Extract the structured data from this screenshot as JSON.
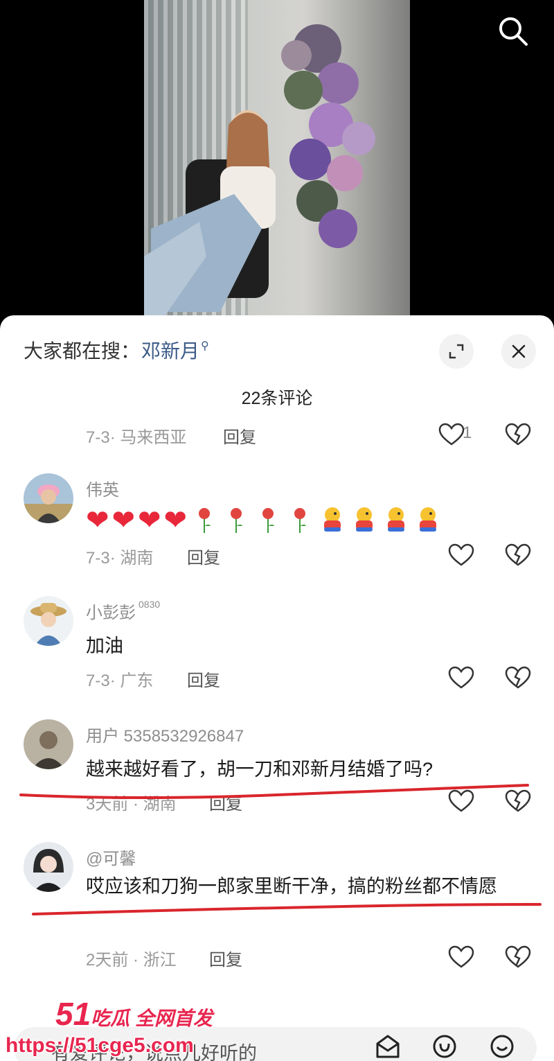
{
  "header": {
    "search_icon": "search-icon"
  },
  "sheet": {
    "hot_search_label": "大家都在搜：",
    "hot_search_term": "邓新月",
    "expand_icon": "expand-icon",
    "close_icon": "close-icon",
    "comment_count": "22条评论"
  },
  "comments": [
    {
      "user": "",
      "text": "",
      "date": "7-3",
      "region": "· 马来西亚",
      "reply": "回复",
      "likes": "1"
    },
    {
      "user": "伟英",
      "emoji": [
        "heart",
        "heart",
        "heart",
        "heart",
        "rose",
        "rose",
        "rose",
        "rose",
        "chick",
        "chick",
        "chick",
        "chick"
      ],
      "date": "7-3",
      "region": "· 湖南",
      "reply": "回复"
    },
    {
      "user": "小彭彭",
      "badge": "0830",
      "text": "加油",
      "date": "7-3",
      "region": "· 广东",
      "reply": "回复"
    },
    {
      "user": "用户 5358532926847",
      "text": "越来越好看了，胡一刀和邓新月结婚了吗?",
      "date": "3天前",
      "region": " · 湖南",
      "reply": "回复"
    },
    {
      "user": "@可馨",
      "text": "哎应该和刀狗一郎家里断干净，搞的粉丝都不情愿",
      "date": "2天前",
      "region": " · 浙江",
      "reply": "回复"
    }
  ],
  "input_bar": {
    "placeholder": "有爱评论，说点儿好听的",
    "icons": [
      "gift-envelope-icon",
      "at-mention-icon",
      "emoji-smile-icon"
    ]
  },
  "watermark": {
    "brand_number": "51",
    "brand_text": "吃瓜 全网首发",
    "url": "https://51cge5.com"
  },
  "colors": {
    "accent_link": "#3b5a86",
    "underline_red": "#d9262c",
    "watermark_pink": "#e8264f"
  }
}
